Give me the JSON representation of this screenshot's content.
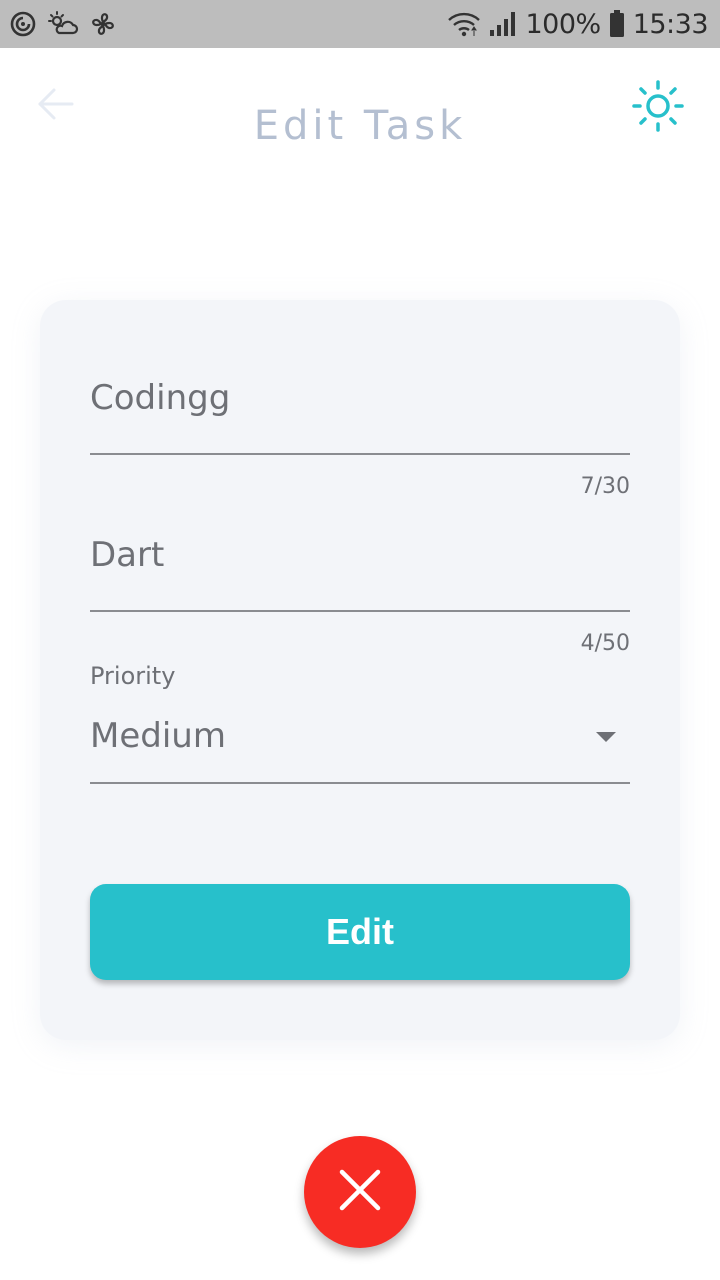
{
  "status_bar": {
    "left_icons": [
      "notification-swirl-icon",
      "weather-icon",
      "fan-icon"
    ],
    "right_icons": [
      "wifi-icon",
      "signal-icon",
      "battery-icon"
    ],
    "battery": "100%",
    "time": "15:33"
  },
  "app_bar": {
    "back_icon": "arrow-left-icon",
    "title": "Edit Task",
    "theme_icon": "sun-icon"
  },
  "form": {
    "title_field": {
      "value": "Codingg",
      "counter": "7/30"
    },
    "description_field": {
      "value": "Dart",
      "counter": "4/50"
    },
    "priority_field": {
      "label": "Priority",
      "value": "Medium"
    },
    "submit_label": "Edit"
  },
  "fab": {
    "icon": "close-icon"
  },
  "colors": {
    "accent": "#27c0cb",
    "danger": "#f72c24",
    "title": "#b4bfd1",
    "card": "#f3f5f9",
    "status_bar": "#bdbdbd"
  }
}
